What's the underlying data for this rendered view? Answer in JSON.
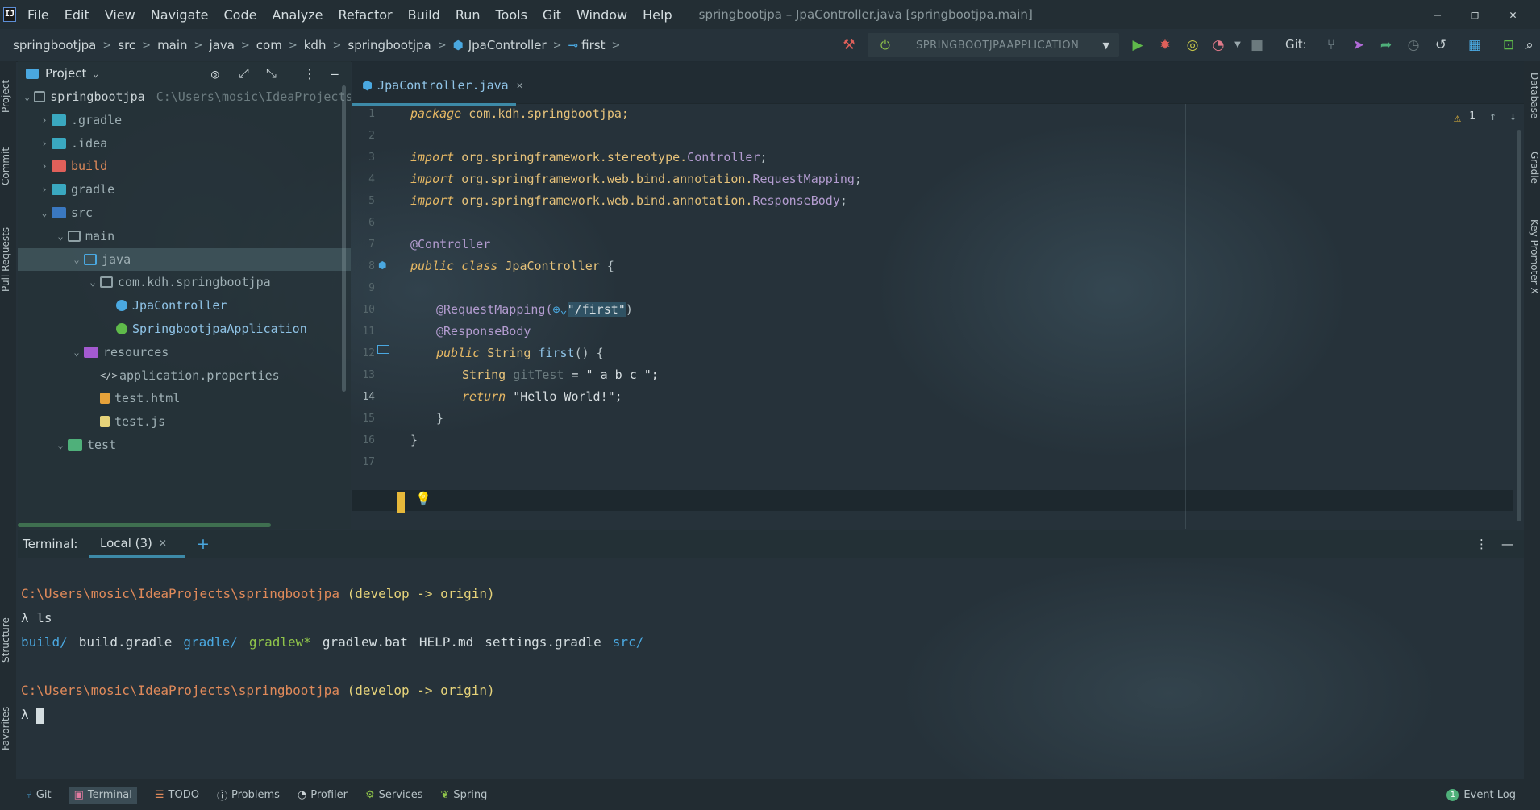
{
  "window": {
    "logo": "IJ",
    "menu": [
      "File",
      "Edit",
      "View",
      "Navigate",
      "Code",
      "Analyze",
      "Refactor",
      "Build",
      "Run",
      "Tools",
      "Git",
      "Window",
      "Help"
    ],
    "title": "springbootjpa – JpaController.java [springbootjpa.main]",
    "controls": {
      "minimize": "—",
      "restore": "❐",
      "close": "✕"
    }
  },
  "breadcrumb": [
    "springbootjpa",
    "src",
    "main",
    "java",
    "com",
    "kdh",
    "springbootjpa",
    "JpaController",
    "first"
  ],
  "toolbar": {
    "run_config": "SPRINGBOOTJPAAPPLICATION",
    "git_label": "Git:"
  },
  "left_stripe": {
    "project": "Project",
    "commit": "Commit",
    "pull_requests": "Pull Requests",
    "structure": "Structure",
    "favorites": "Favorites"
  },
  "right_stripe": {
    "database": "Database",
    "gradle": "Gradle",
    "key_promoter": "Key Promoter X"
  },
  "project": {
    "header": "Project",
    "tree": [
      {
        "label": "springbootjpa",
        "path": "C:\\Users\\mosic\\IdeaProjects\\sp",
        "depth": 0,
        "arrow": "open",
        "icon": "module"
      },
      {
        "label": ".gradle",
        "depth": 1,
        "arrow": "closed",
        "icon": "folder-teal"
      },
      {
        "label": ".idea",
        "depth": 1,
        "arrow": "closed",
        "icon": "folder-teal"
      },
      {
        "label": "build",
        "depth": 1,
        "arrow": "closed",
        "icon": "folder-red"
      },
      {
        "label": "gradle",
        "depth": 1,
        "arrow": "closed",
        "icon": "folder-teal"
      },
      {
        "label": "src",
        "depth": 1,
        "arrow": "open",
        "icon": "folder-src"
      },
      {
        "label": "main",
        "depth": 2,
        "arrow": "open",
        "icon": "folder"
      },
      {
        "label": "java",
        "depth": 3,
        "arrow": "open",
        "icon": "folder-blue",
        "selected": true
      },
      {
        "label": "com.kdh.springbootjpa",
        "depth": 4,
        "arrow": "open",
        "icon": "folder"
      },
      {
        "label": "JpaController",
        "depth": 5,
        "arrow": "none",
        "icon": "class"
      },
      {
        "label": "SpringbootjpaApplication",
        "depth": 5,
        "arrow": "none",
        "icon": "spring-class"
      },
      {
        "label": "resources",
        "depth": 3,
        "arrow": "open",
        "icon": "folder-res"
      },
      {
        "label": "application.properties",
        "depth": 4,
        "arrow": "none",
        "icon": "props"
      },
      {
        "label": "test.html",
        "depth": 4,
        "arrow": "none",
        "icon": "html"
      },
      {
        "label": "test.js",
        "depth": 4,
        "arrow": "none",
        "icon": "js"
      },
      {
        "label": "test",
        "depth": 2,
        "arrow": "open",
        "icon": "folder-green"
      }
    ]
  },
  "editor": {
    "tab": "JpaController.java",
    "warnings": "1",
    "lines": [
      "1",
      "2",
      "3",
      "4",
      "5",
      "6",
      "7",
      "8",
      "9",
      "10",
      "11",
      "12",
      "13",
      "14",
      "15",
      "16",
      "17"
    ],
    "code": {
      "l1_kw": "package",
      "l1_rest": " com.kdh.springbootjpa;",
      "l3_kw": "import",
      "l3_pkg": " org.springframework.stereotype.",
      "l3_cls": "Controller",
      "l3_end": ";",
      "l4_kw": "import",
      "l4_pkg": " org.springframework.web.bind.annotation.",
      "l4_cls": "RequestMapping",
      "l4_end": ";",
      "l5_kw": "import",
      "l5_pkg": " org.springframework.web.bind.annotation.",
      "l5_cls": "ResponseBody",
      "l5_end": ";",
      "l7": "@Controller",
      "l8_kw": "public class",
      "l8_name": " JpaController",
      "l8_end": " {",
      "l10_ann": "@RequestMapping(",
      "l10_str": "\"/first\"",
      "l10_end": ")",
      "l11": "@ResponseBody",
      "l12_kw": "public",
      "l12_type": " String ",
      "l12_fn": "first",
      "l12_end": "() {",
      "l13_type": "String ",
      "l13_var": "gitTest",
      "l13_rest": " = \" a b c \";",
      "l14_kw": "return",
      "l14_str": " \"Hello World!\";",
      "l15": "}",
      "l16": "}"
    }
  },
  "terminal": {
    "label": "Terminal:",
    "tab": "Local (3)",
    "add": "+",
    "path1": "C:\\Users\\mosic\\IdeaProjects\\springbootjpa",
    "branch1": " (develop -> origin)",
    "cmd": "λ ls",
    "ls": [
      {
        "name": "build/",
        "kind": "dir"
      },
      {
        "name": "build.gradle",
        "kind": "file"
      },
      {
        "name": "gradle/",
        "kind": "dir"
      },
      {
        "name": "gradlew*",
        "kind": "exec"
      },
      {
        "name": "gradlew.bat",
        "kind": "file"
      },
      {
        "name": "HELP.md",
        "kind": "file"
      },
      {
        "name": "settings.gradle",
        "kind": "file"
      },
      {
        "name": "src/",
        "kind": "dir"
      }
    ],
    "path2": "C:\\Users\\mosic\\IdeaProjects\\springbootjpa",
    "branch2": " (develop -> origin)",
    "prompt": "λ "
  },
  "bottombar": {
    "items": [
      "Git",
      "Terminal",
      "TODO",
      "Problems",
      "Profiler",
      "Services",
      "Spring"
    ],
    "event_count": "1",
    "event_log": "Event Log"
  },
  "colors": {
    "accent": "#3d8aa8",
    "path_orange": "#e08a5a",
    "branch_yellow": "#e6d37a",
    "dir_blue": "#4aa8e0",
    "exec_green": "#8fc34a"
  }
}
